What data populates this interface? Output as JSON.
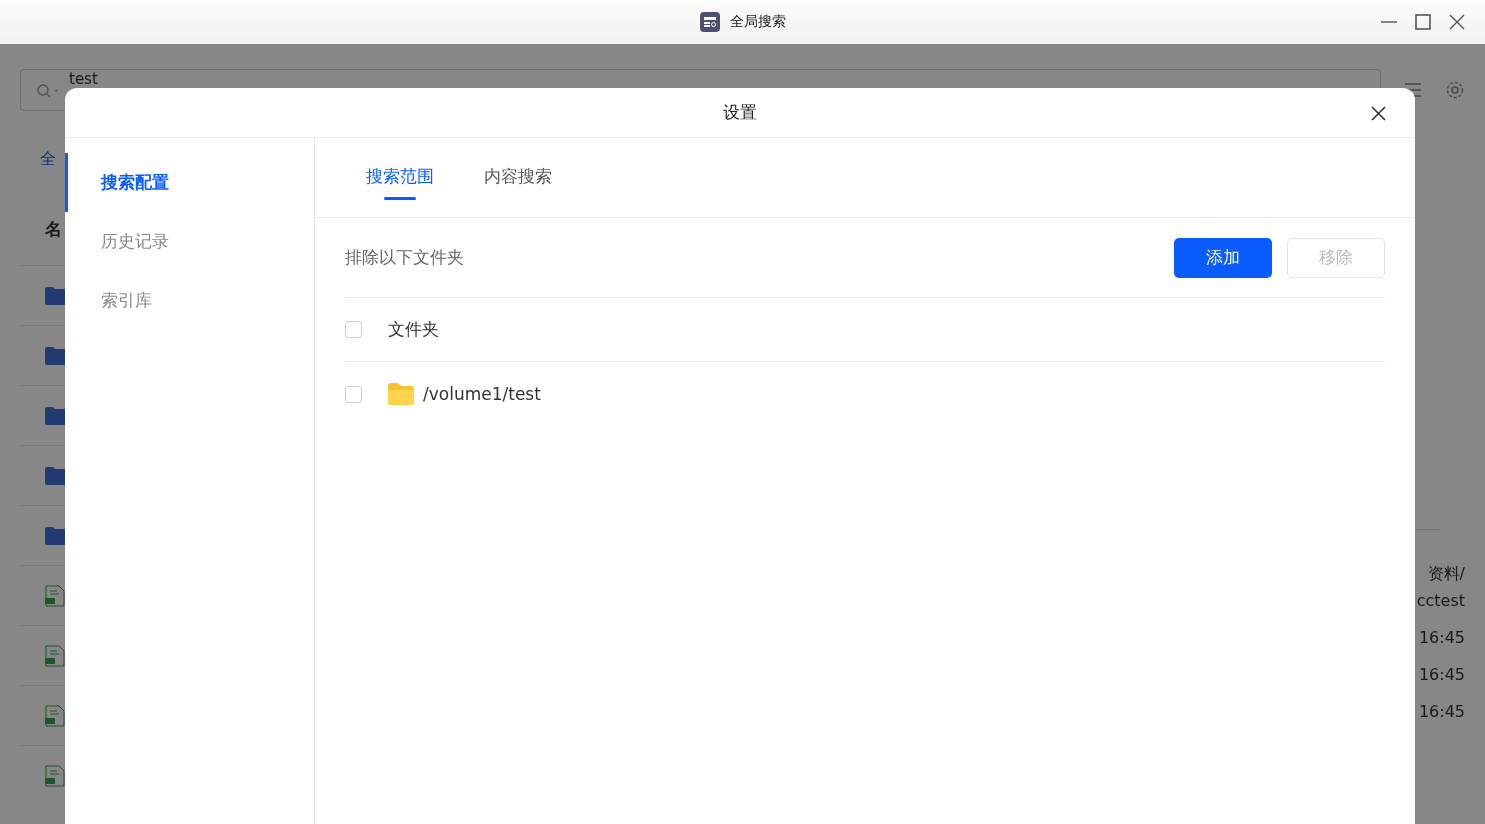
{
  "window": {
    "title": "全局搜索"
  },
  "background": {
    "search": {
      "value": "test"
    },
    "tab": "全",
    "column_header": "名",
    "rows": [
      {
        "kind": "folder"
      },
      {
        "kind": "folder"
      },
      {
        "kind": "folder"
      },
      {
        "kind": "folder"
      },
      {
        "kind": "folder"
      },
      {
        "kind": "txt"
      },
      {
        "kind": "txt"
      },
      {
        "kind": "txt"
      },
      {
        "kind": "txt"
      }
    ],
    "detail": [
      "资料/",
      "cctest",
      "16:45",
      "16:45",
      "16:45"
    ]
  },
  "dialog": {
    "title": "设置",
    "sidebar": [
      {
        "label": "搜索配置",
        "selected": true
      },
      {
        "label": "历史记录",
        "selected": false
      },
      {
        "label": "索引库",
        "selected": false
      }
    ],
    "tabs": [
      {
        "label": "搜索范围",
        "selected": true
      },
      {
        "label": "内容搜索",
        "selected": false
      }
    ],
    "section_label": "排除以下文件夹",
    "buttons": [
      {
        "label": "添加",
        "disabled": false
      },
      {
        "label": "移除",
        "disabled": true
      }
    ],
    "table": {
      "header": {
        "label": "文件夹",
        "checked": false
      },
      "rows": [
        {
          "path": "/volume1/test",
          "checked": false
        }
      ]
    }
  }
}
